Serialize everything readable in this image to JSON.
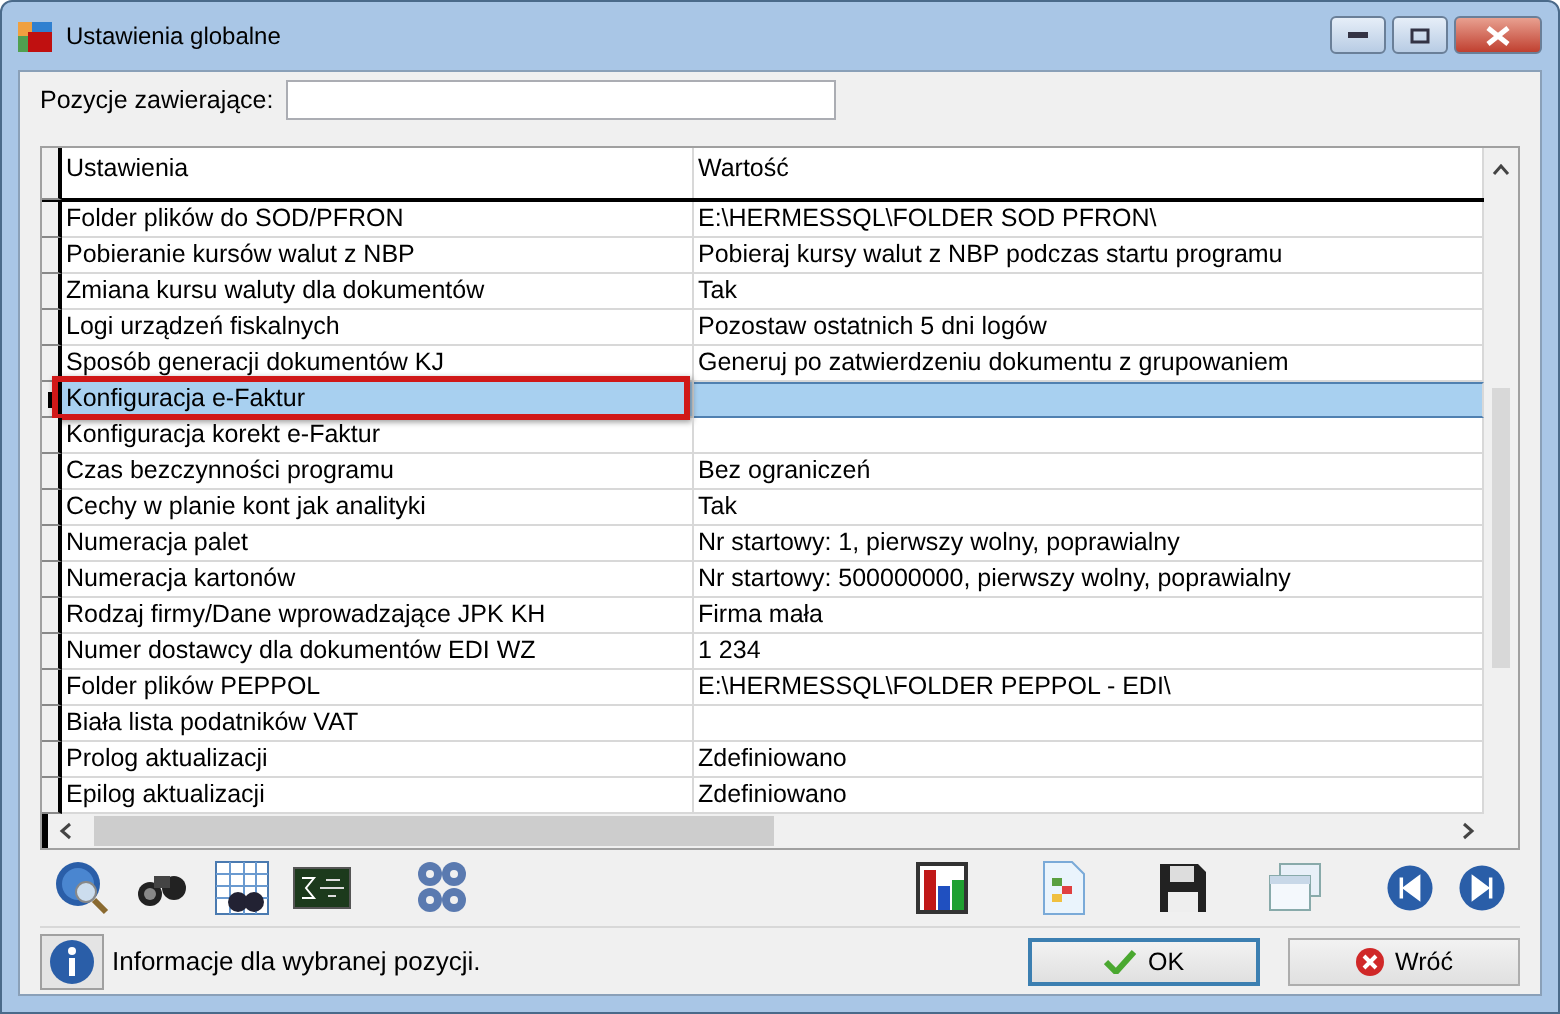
{
  "window": {
    "title": "Ustawienia globalne"
  },
  "filter": {
    "label": "Pozycje zawierające:"
  },
  "table": {
    "columns": [
      "Ustawienia",
      "Wartość"
    ],
    "rows": [
      {
        "name": "Folder plików do SOD/PFRON",
        "value": "E:\\HERMESSQL\\FOLDER SOD PFRON\\",
        "selected": false
      },
      {
        "name": "Pobieranie kursów walut z NBP",
        "value": "Pobieraj kursy walut z NBP podczas startu programu",
        "selected": false
      },
      {
        "name": "Zmiana kursu waluty dla dokumentów",
        "value": "Tak",
        "selected": false
      },
      {
        "name": "Logi urządzeń fiskalnych",
        "value": "Pozostaw ostatnich  5 dni logów",
        "selected": false
      },
      {
        "name": "Sposób generacji dokumentów KJ",
        "value": "Generuj po zatwierdzeniu dokumentu z grupowaniem",
        "selected": false
      },
      {
        "name": "Konfiguracja e-Faktur",
        "selected": true,
        "highlighted": true
      },
      {
        "name": "Konfiguracja korekt e-Faktur",
        "selected": false
      },
      {
        "name": "Czas bezczynności programu",
        "value": "Bez ograniczeń",
        "selected": false
      },
      {
        "name": "Cechy w planie kont jak analityki",
        "value": "Tak",
        "selected": false
      },
      {
        "name": "Numeracja palet",
        "value": "Nr startowy: 1, pierwszy wolny, poprawialny",
        "selected": false
      },
      {
        "name": "Numeracja kartonów",
        "value": "Nr startowy: 500000000, pierwszy wolny, poprawialny",
        "selected": false
      },
      {
        "name": "Rodzaj firmy/Dane wprowadzające JPK KH",
        "value": "Firma mała",
        "selected": false
      },
      {
        "name": "Numer dostawcy dla dokumentów EDI WZ",
        "value": "1 234",
        "selected": false
      },
      {
        "name": "Folder plików PEPPOL",
        "value": "E:\\HERMESSQL\\FOLDER PEPPOL - EDI\\",
        "selected": false
      },
      {
        "name": "Biała lista podatników VAT",
        "selected": false
      },
      {
        "name": "Prolog aktualizacji",
        "value": "Zdefiniowano",
        "selected": false
      },
      {
        "name": "Epilog aktualizacji",
        "value": "Zdefiniowano",
        "selected": false
      }
    ]
  },
  "status": {
    "text": "Informacje dla wybranej pozycji."
  },
  "buttons": [
    {
      "label": "OK",
      "kind": "ok"
    },
    {
      "label": "Wróć",
      "kind": "cancel"
    }
  ]
}
